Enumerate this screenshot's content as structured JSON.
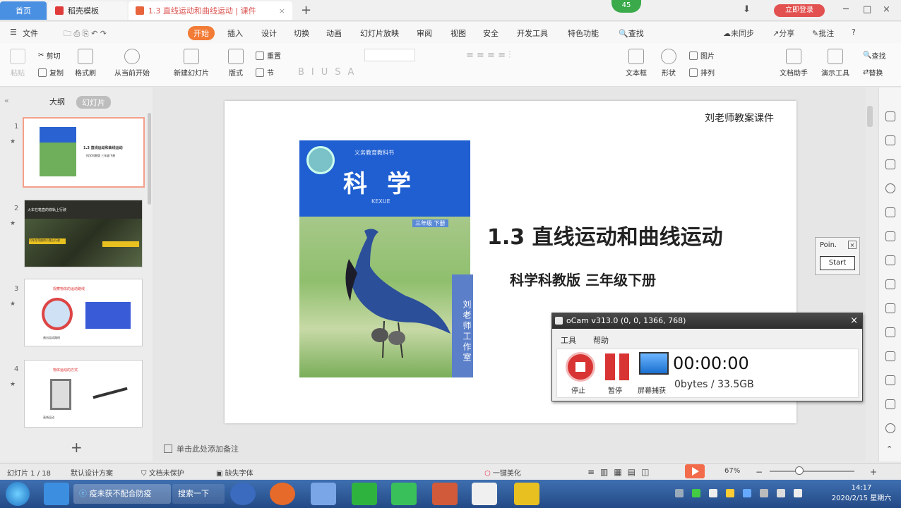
{
  "tabs": {
    "home": "首页",
    "shell": "稻壳模板",
    "doc": "1.3 直线运动和曲线运动 | 课件",
    "add": "+"
  },
  "notifications": {
    "count": "45"
  },
  "header": {
    "login": "立即登录"
  },
  "menu": {
    "file": "文件",
    "items": [
      "开始",
      "插入",
      "设计",
      "切换",
      "动画",
      "幻灯片放映",
      "审阅",
      "视图",
      "安全",
      "开发工具",
      "特色功能"
    ],
    "search": "查找",
    "sync": "未同步",
    "share": "分享",
    "comment": "批注",
    "help": "?"
  },
  "ribbon": {
    "paste": "粘贴",
    "cut": "剪切",
    "copy": "复制",
    "format_painter": "格式刷",
    "from_current": "从当前开始",
    "new_slide": "新建幻灯片",
    "layout": "版式",
    "reset": "重置",
    "section": "节",
    "font_buttons": [
      "B",
      "I",
      "U",
      "S",
      "A"
    ],
    "textbox": "文本框",
    "shapes": "形状",
    "image": "图片",
    "arrange": "排列",
    "presenter_tools": "文档助手",
    "presentation_tools": "演示工具",
    "find": "查找",
    "replace": "替换"
  },
  "left_panel": {
    "outline_tab": "大纲",
    "slides_tab": "幻灯片",
    "thumbs": [
      {
        "num": "1",
        "text": "1.3 直线运动和曲线运动",
        "sub": "科学科教版  三年级下册"
      },
      {
        "num": "2",
        "text": "火车在笔直的铁轨上行驶",
        "sub": "汽车在弯曲的公路上行驶"
      },
      {
        "num": "3",
        "text": "观察物体的运动路线",
        "sub": "画出运动路线"
      },
      {
        "num": "4",
        "text": "物体运动的方式",
        "sub": "直线运动"
      }
    ],
    "add": "+"
  },
  "slide": {
    "author": "刘老师教案课件",
    "cover": {
      "subtitle": "义务教育教科书",
      "title": "科学",
      "pinyin": "KEXUE",
      "grade": "三年级 下册",
      "side": "刘老师工作室"
    },
    "title": "1.3 直线运动和曲线运动",
    "subtitle": "科学科教版    三年级下册"
  },
  "pointer": {
    "label": "Poin.",
    "close": "×",
    "start": "Start"
  },
  "ocam": {
    "title": "oCam v313.0 (0, 0, 1366, 768)",
    "close": "×",
    "menu_tools": "工具",
    "menu_help": "帮助",
    "stop": "停止",
    "pause": "暂停",
    "screen": "屏幕捕获",
    "time": "00:00:00",
    "size": "0bytes / 33.5GB"
  },
  "notes": {
    "placeholder": "单击此处添加备注"
  },
  "status": {
    "slide_count": "幻灯片 1 / 18",
    "theme": "默认设计方案",
    "protect": "文档未保护",
    "font_missing": "缺失字体",
    "beautify": "一键美化",
    "zoom": "67%"
  },
  "taskbar": {
    "task1": "疫未获不配合防疫",
    "task2": "搜索一下",
    "time": "14:17",
    "date": "2020/2/15 星期六"
  }
}
